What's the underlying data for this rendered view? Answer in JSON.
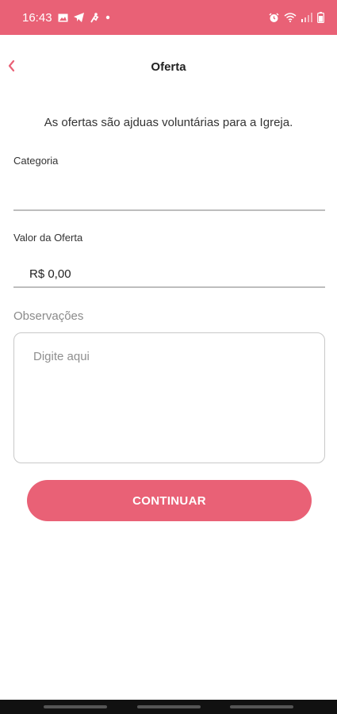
{
  "status_bar": {
    "time": "16:43",
    "background_color": "#e96176",
    "left_icons": [
      "gallery-icon",
      "telegram-icon",
      "activity-icon",
      "dot-icon"
    ],
    "right_icons": [
      "alarm-icon",
      "wifi-icon",
      "signal-icon",
      "battery-icon"
    ]
  },
  "header": {
    "title": "Oferta",
    "back_icon": "chevron-left-icon",
    "accent_color": "#e96176"
  },
  "intro_text": "As ofertas são ajduas voluntárias para a Igreja.",
  "form": {
    "categoria": {
      "label": "Categoria",
      "value": ""
    },
    "valor": {
      "label": "Valor da Oferta",
      "value": "R$ 0,00"
    },
    "observacoes": {
      "label": "Observações",
      "placeholder": "Digite aqui"
    }
  },
  "continue_button": {
    "label": "CONTINUAR",
    "color": "#e96176"
  }
}
